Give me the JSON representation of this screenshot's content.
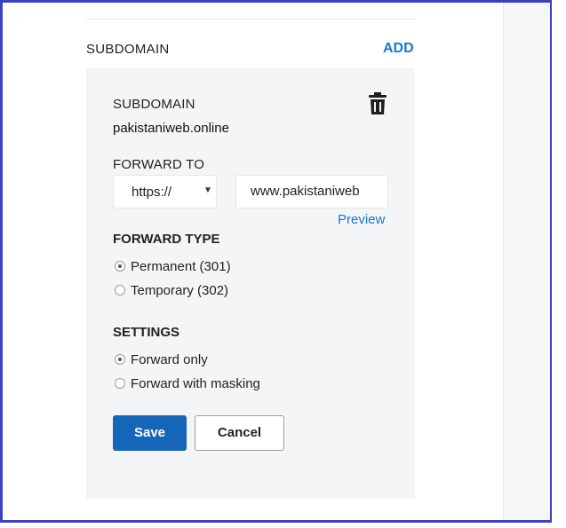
{
  "section": {
    "title": "SUBDOMAIN",
    "add_label": "ADD"
  },
  "panel": {
    "subdomain_label": "SUBDOMAIN",
    "subdomain_value": "pakistaniweb.online",
    "delete_icon": "trash-icon",
    "forward_to_label": "FORWARD TO",
    "protocol_value": "https://",
    "destination_value": "www.pakistaniweb",
    "preview_label": "Preview",
    "forward_type": {
      "heading": "FORWARD TYPE",
      "options": [
        {
          "label": "Permanent (301)",
          "selected": true
        },
        {
          "label": "Temporary (302)",
          "selected": false
        }
      ]
    },
    "settings": {
      "heading": "SETTINGS",
      "options": [
        {
          "label": "Forward only",
          "selected": true
        },
        {
          "label": "Forward with masking",
          "selected": false
        }
      ]
    },
    "save_label": "Save",
    "cancel_label": "Cancel"
  },
  "colors": {
    "accent": "#1976d2",
    "primary_button": "#1565b8",
    "frame_border": "#3b3fc4",
    "panel_bg": "#f4f5f6"
  }
}
